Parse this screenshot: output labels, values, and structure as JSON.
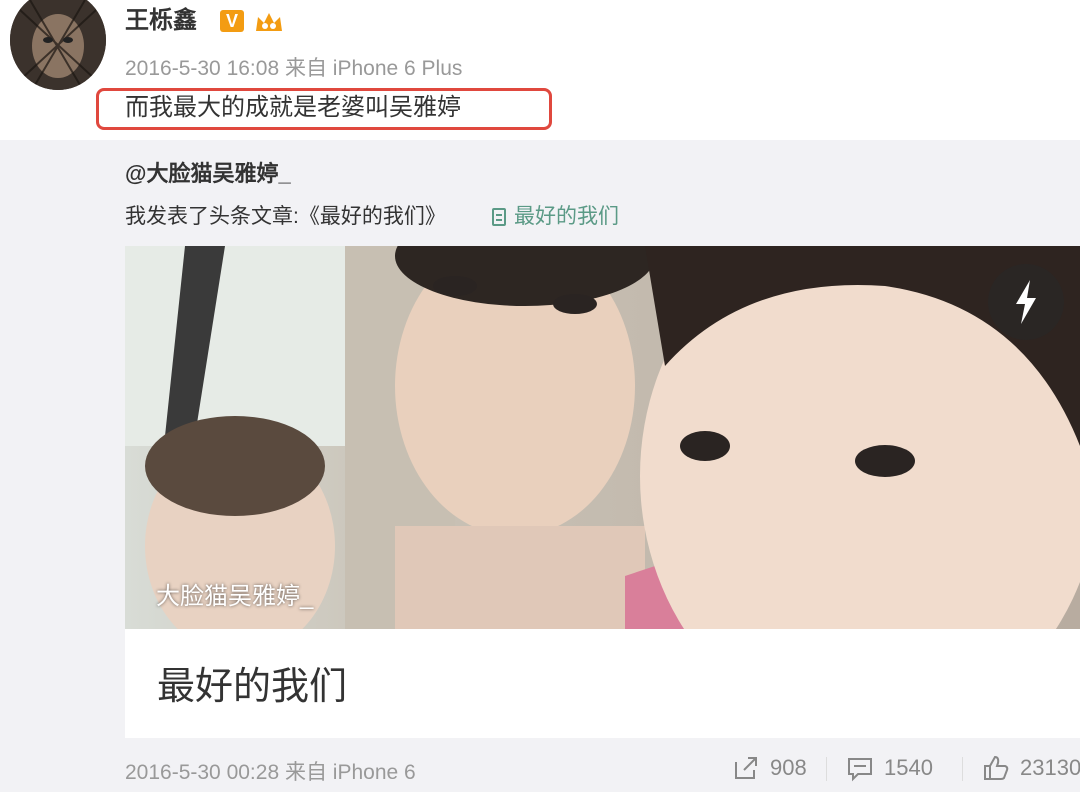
{
  "post": {
    "username": "王栎鑫",
    "verified_badge": "V",
    "timestamp": "2016-5-30 16:08 来自 iPhone 6 Plus",
    "text": "而我最大的成就是老婆叫吴雅婷",
    "highlight_color": "#e0483e"
  },
  "repost": {
    "user": "@大脸猫吴雅婷_",
    "text": "我发表了头条文章:《最好的我们》",
    "article_link": "最好的我们",
    "photo_caption": "大脸猫吴雅婷_",
    "article_title": "最好的我们",
    "timestamp": "2016-5-30 00:28 来自 iPhone 6"
  },
  "actions": {
    "share_count": "908",
    "comment_count": "1540",
    "like_count": "23130"
  },
  "icons": [
    "avatar",
    "verified-v-icon",
    "crown-icon",
    "document-icon",
    "lightning-icon",
    "share-icon",
    "comment-icon",
    "like-icon"
  ],
  "colors": {
    "link": "#5b9a86",
    "repost_bg": "#f2f2f5",
    "meta": "#999999"
  }
}
